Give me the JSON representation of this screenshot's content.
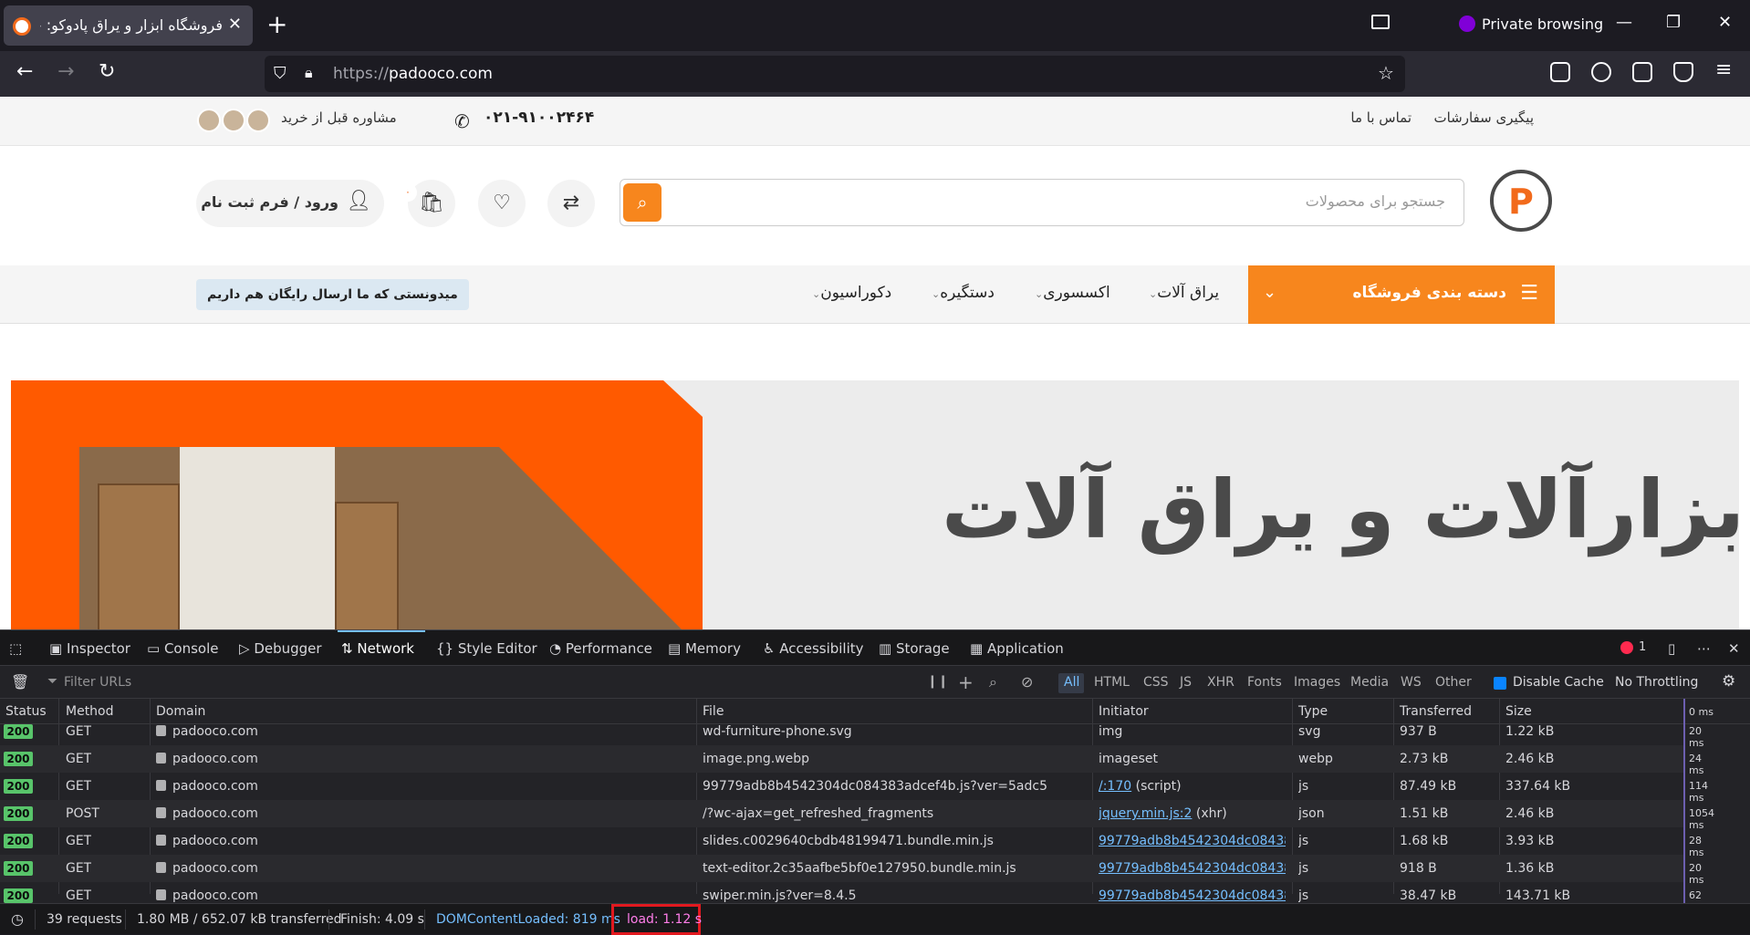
{
  "browser": {
    "tab_title": "فروشگاه ابزار و یراق پادوکو: خرید",
    "private_label": "Private browsing",
    "url_protocol": "https://",
    "url_host": "padooco.com"
  },
  "site": {
    "topbar": {
      "order_tracking": "پیگیری سفارشات",
      "contact_us": "تماس با ما",
      "phone": "۰۲۱-۹۱۰۰۲۴۶۴",
      "advice": "مشاوره قبل از خرید"
    },
    "search_placeholder": "جستجو برای محصولات",
    "cart_count": "۰",
    "login_label": "ورود / فرم ثبت نام",
    "category_button": "دسته بندی فروشگاه",
    "menu": [
      "یراق آلات",
      "اکسسوری",
      "دستگیره",
      "دکوراسیون"
    ],
    "free_shipping": "میدونستی که ما ارسال رایگان هم داریم",
    "hero_title": "ابزارآلات و یراق آلات"
  },
  "devtools": {
    "tabs": [
      "Inspector",
      "Console",
      "Debugger",
      "Network",
      "Style Editor",
      "Performance",
      "Memory",
      "Accessibility",
      "Storage",
      "Application"
    ],
    "active_tab": "Network",
    "error_count": "1",
    "filter_placeholder": "Filter URLs",
    "filter_types": [
      "All",
      "HTML",
      "CSS",
      "JS",
      "XHR",
      "Fonts",
      "Images",
      "Media",
      "WS",
      "Other"
    ],
    "disable_cache": "Disable Cache",
    "throttling": "No Throttling",
    "columns": [
      "Status",
      "Method",
      "Domain",
      "File",
      "Initiator",
      "Type",
      "Transferred",
      "Size",
      "0 ms"
    ],
    "rows": [
      {
        "status": "200",
        "method": "GET",
        "domain": "padooco.com",
        "file": "wd-furniture-phone.svg",
        "initiator": "img",
        "initiator_link": "",
        "type": "svg",
        "transferred": "937 B",
        "size": "1.22 kB",
        "time": "20 ms"
      },
      {
        "status": "200",
        "method": "GET",
        "domain": "padooco.com",
        "file": "image.png.webp",
        "initiator": "imageset",
        "initiator_link": "",
        "type": "webp",
        "transferred": "2.73 kB",
        "size": "2.46 kB",
        "time": "24 ms"
      },
      {
        "status": "200",
        "method": "GET",
        "domain": "padooco.com",
        "file": "99779adb8b4542304dc084383adcef4b.js?ver=5adc5",
        "initiator": " (script)",
        "initiator_link": "/:170",
        "type": "js",
        "transferred": "87.49 kB",
        "size": "337.64 kB",
        "time": "114 ms"
      },
      {
        "status": "200",
        "method": "POST",
        "domain": "padooco.com",
        "file": "/?wc-ajax=get_refreshed_fragments",
        "initiator": " (xhr)",
        "initiator_link": "jquery.min.js:2",
        "type": "json",
        "transferred": "1.51 kB",
        "size": "2.46 kB",
        "time": "1054 ms"
      },
      {
        "status": "200",
        "method": "GET",
        "domain": "padooco.com",
        "file": "slides.c0029640cbdb48199471.bundle.min.js",
        "initiator": "",
        "initiator_link": "99779adb8b4542304dc08438...",
        "type": "js",
        "transferred": "1.68 kB",
        "size": "3.93 kB",
        "time": "28 ms"
      },
      {
        "status": "200",
        "method": "GET",
        "domain": "padooco.com",
        "file": "text-editor.2c35aafbe5bf0e127950.bundle.min.js",
        "initiator": "",
        "initiator_link": "99779adb8b4542304dc08438...",
        "type": "js",
        "transferred": "918 B",
        "size": "1.36 kB",
        "time": "20 ms"
      },
      {
        "status": "200",
        "method": "GET",
        "domain": "padooco.com",
        "file": "swiper.min.js?ver=8.4.5",
        "initiator": "",
        "initiator_link": "99779adb8b4542304dc08438...",
        "type": "js",
        "transferred": "38.47 kB",
        "size": "143.71 kB",
        "time": "62 ms"
      }
    ],
    "status_bar": {
      "requests": "39 requests",
      "transferred": "1.80 MB / 652.07 kB transferred",
      "finish": "Finish: 4.09 s",
      "dom_loaded": "DOMContentLoaded: 819 ms",
      "load": "load: 1.12 s"
    }
  }
}
